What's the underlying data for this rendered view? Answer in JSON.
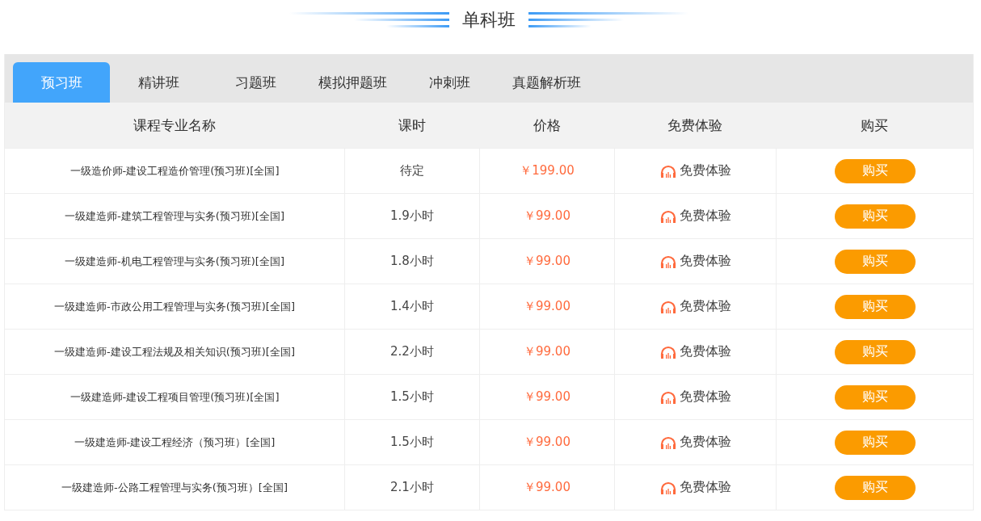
{
  "section_title": "单科班",
  "tabs": [
    {
      "label": "预习班",
      "selected": true
    },
    {
      "label": "精讲班",
      "selected": false
    },
    {
      "label": "习题班",
      "selected": false
    },
    {
      "label": "模拟押题班",
      "selected": false
    },
    {
      "label": "冲刺班",
      "selected": false
    },
    {
      "label": "真题解析班",
      "selected": false
    }
  ],
  "table": {
    "columns": [
      "课程专业名称",
      "课时",
      "价格",
      "免费体验",
      "购买"
    ],
    "rows": [
      {
        "name": "一级造价师-建设工程造价管理(预习班)[全国]",
        "hours": "待定",
        "price": "￥199.00",
        "trial": "免费体验",
        "buy": "购买"
      },
      {
        "name": "一级建造师-建筑工程管理与实务(预习班)[全国]",
        "hours": "1.9小时",
        "price": "￥99.00",
        "trial": "免费体验",
        "buy": "购买"
      },
      {
        "name": "一级建造师-机电工程管理与实务(预习班)[全国]",
        "hours": "1.8小时",
        "price": "￥99.00",
        "trial": "免费体验",
        "buy": "购买"
      },
      {
        "name": "一级建造师-市政公用工程管理与实务(预习班)[全国]",
        "hours": "1.4小时",
        "price": "￥99.00",
        "trial": "免费体验",
        "buy": "购买"
      },
      {
        "name": "一级建造师-建设工程法规及相关知识(预习班)[全国]",
        "hours": "2.2小时",
        "price": "￥99.00",
        "trial": "免费体验",
        "buy": "购买"
      },
      {
        "name": "一级建造师-建设工程项目管理(预习班)[全国]",
        "hours": "1.5小时",
        "price": "￥99.00",
        "trial": "免费体验",
        "buy": "购买"
      },
      {
        "name": "一级建造师-建设工程经济（预习班）[全国]",
        "hours": "1.5小时",
        "price": "￥99.00",
        "trial": "免费体验",
        "buy": "购买"
      },
      {
        "name": "一级建造师-公路工程管理与实务(预习班）[全国]",
        "hours": "2.1小时",
        "price": "￥99.00",
        "trial": "免费体验",
        "buy": "购买"
      }
    ]
  }
}
